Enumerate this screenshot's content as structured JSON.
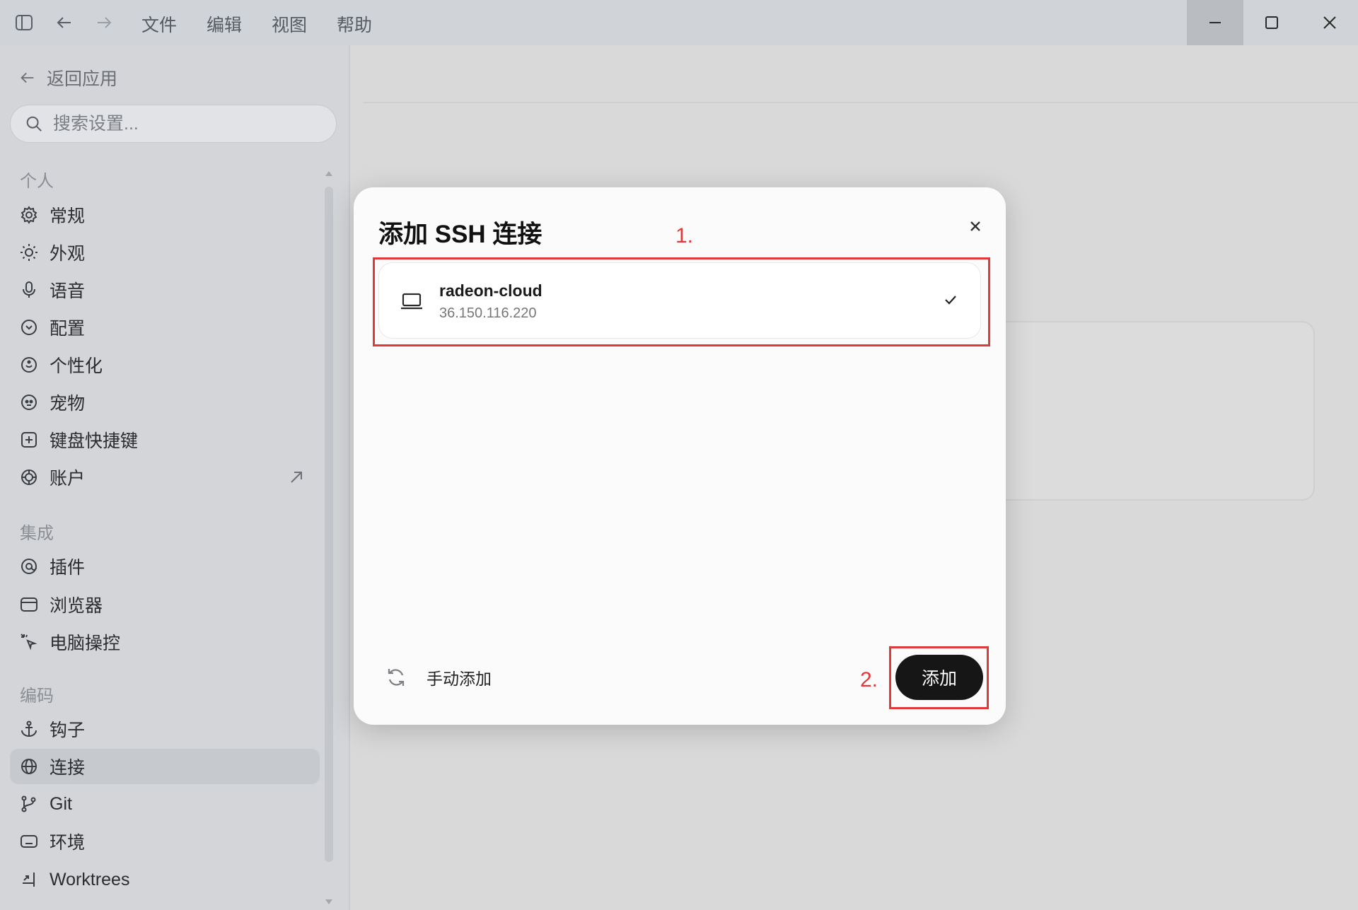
{
  "titlebar": {
    "menus": [
      "文件",
      "编辑",
      "视图",
      "帮助"
    ]
  },
  "sidebar": {
    "back_label": "返回应用",
    "search_placeholder": "搜索设置...",
    "sections": {
      "personal": "个人",
      "integrations": "集成",
      "coding": "编码"
    },
    "items": [
      {
        "label": "常规",
        "icon": "gear-icon"
      },
      {
        "label": "外观",
        "icon": "sun-icon"
      },
      {
        "label": "语音",
        "icon": "microphone-icon"
      },
      {
        "label": "配置",
        "icon": "profile-icon"
      },
      {
        "label": "个性化",
        "icon": "personalize-icon"
      },
      {
        "label": "宠物",
        "icon": "pet-icon"
      },
      {
        "label": "键盘快捷键",
        "icon": "keyboard-icon"
      },
      {
        "label": "账户",
        "icon": "account-icon"
      },
      {
        "label": "插件",
        "icon": "plugin-icon"
      },
      {
        "label": "浏览器",
        "icon": "browser-icon"
      },
      {
        "label": "电脑操控",
        "icon": "computer-control-icon"
      },
      {
        "label": "钩子",
        "icon": "anchor-icon"
      },
      {
        "label": "连接",
        "icon": "globe-icon"
      },
      {
        "label": "Git",
        "icon": "git-branch-icon"
      },
      {
        "label": "环境",
        "icon": "environment-icon"
      },
      {
        "label": "Worktrees",
        "icon": "worktree-icon"
      }
    ],
    "selected": "连接"
  },
  "dialog": {
    "title": "添加 SSH 连接",
    "connection": {
      "name": "radeon-cloud",
      "ip": "36.150.116.220",
      "selected": true
    },
    "manual_add_label": "手动添加",
    "add_button_label": "添加",
    "step_labels": [
      "1.",
      "2."
    ]
  },
  "colors": {
    "annotation_red": "#e0393a",
    "primary_button": "#161616"
  }
}
